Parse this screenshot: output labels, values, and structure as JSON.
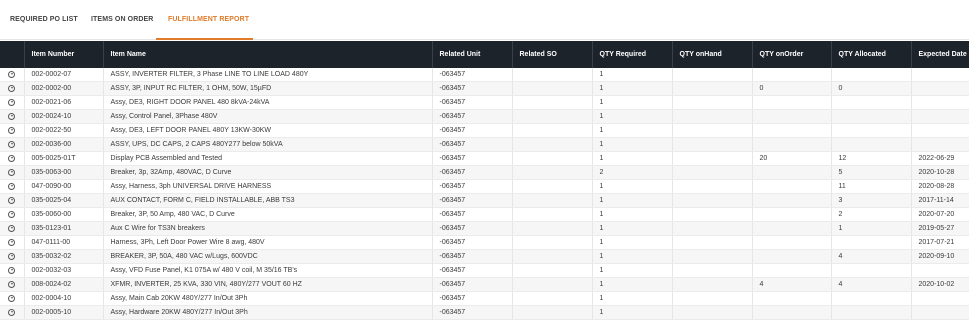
{
  "tabs": [
    {
      "label": "REQUIRED PO LIST"
    },
    {
      "label": "ITEMS ON ORDER"
    },
    {
      "label": "FULFILLMENT REPORT",
      "active": true
    }
  ],
  "accent_color": "#e07b2a",
  "header_bg": "#1d232b",
  "columns": [
    "",
    "Item Number",
    "Item Name",
    "Related Unit",
    "Related SO",
    "QTY Required",
    "QTY onHand",
    "QTY onOrder",
    "QTY Allocated",
    "Expected Date"
  ],
  "rows": [
    {
      "item": "002-0002-07",
      "name": "ASSY, INVERTER FILTER, 3 Phase LINE TO LINE LOAD 480Y",
      "unit": "-063457",
      "so": "",
      "req": "1",
      "onhand": "",
      "onorder": "",
      "alloc": "",
      "date": ""
    },
    {
      "item": "002-0002-00",
      "name": "ASSY, 3P, INPUT RC FILTER, 1 OHM, 50W, 15µFD",
      "unit": "-063457",
      "so": "",
      "req": "1",
      "onhand": "",
      "onorder": "0",
      "alloc": "0",
      "date": ""
    },
    {
      "item": "002-0021-06",
      "name": "Assy, DE3, RIGHT DOOR PANEL 480 8kVA-24kVA",
      "unit": "-063457",
      "so": "",
      "req": "1",
      "onhand": "",
      "onorder": "",
      "alloc": "",
      "date": ""
    },
    {
      "item": "002-0024-10",
      "name": "Assy, Control Panel, 3Phase 480V",
      "unit": "-063457",
      "so": "",
      "req": "1",
      "onhand": "",
      "onorder": "",
      "alloc": "",
      "date": ""
    },
    {
      "item": "002-0022-50",
      "name": "Assy, DE3, LEFT DOOR PANEL 480Y 13KW-30KW",
      "unit": "-063457",
      "so": "",
      "req": "1",
      "onhand": "",
      "onorder": "",
      "alloc": "",
      "date": ""
    },
    {
      "item": "002-0036-00",
      "name": "ASSY, UPS, DC CAPS, 2 CAPS 480Y277 below 50kVA",
      "unit": "-063457",
      "so": "",
      "req": "1",
      "onhand": "",
      "onorder": "",
      "alloc": "",
      "date": ""
    },
    {
      "item": "005-0025-01T",
      "name": "Display PCB Assembled and Tested",
      "unit": "-063457",
      "so": "",
      "req": "1",
      "onhand": "",
      "onorder": "20",
      "alloc": "12",
      "date": "2022-06-29"
    },
    {
      "item": "035-0063-00",
      "name": "Breaker, 3p, 32Amp, 480VAC, D Curve",
      "unit": "-063457",
      "so": "",
      "req": "2",
      "onhand": "",
      "onorder": "",
      "alloc": "5",
      "date": "2020-10-28"
    },
    {
      "item": "047-0090-00",
      "name": "Assy, Harness, 3ph UNIVERSAL DRIVE HARNESS",
      "unit": "-063457",
      "so": "",
      "req": "1",
      "onhand": "",
      "onorder": "",
      "alloc": "11",
      "date": "2020-08-28"
    },
    {
      "item": "035-0025-04",
      "name": "AUX CONTACT, FORM C, FIELD INSTALLABLE, ABB TS3",
      "unit": "-063457",
      "so": "",
      "req": "1",
      "onhand": "",
      "onorder": "",
      "alloc": "3",
      "date": "2017-11-14"
    },
    {
      "item": "035-0060-00",
      "name": "Breaker, 3P, 50 Amp, 480 VAC, D Curve",
      "unit": "-063457",
      "so": "",
      "req": "1",
      "onhand": "",
      "onorder": "",
      "alloc": "2",
      "date": "2020-07-20"
    },
    {
      "item": "035-0123-01",
      "name": "Aux C Wire for TS3N breakers",
      "unit": "-063457",
      "so": "",
      "req": "1",
      "onhand": "",
      "onorder": "",
      "alloc": "1",
      "date": "2019-05-27"
    },
    {
      "item": "047-0111-00",
      "name": "Harness, 3Ph, Left Door Power Wire 8 awg, 480V",
      "unit": "-063457",
      "so": "",
      "req": "1",
      "onhand": "",
      "onorder": "",
      "alloc": "",
      "date": "2017-07-21"
    },
    {
      "item": "035-0032-02",
      "name": "BREAKER, 3P, 50A, 480 VAC w/Lugs, 600VDC",
      "unit": "-063457",
      "so": "",
      "req": "1",
      "onhand": "",
      "onorder": "",
      "alloc": "4",
      "date": "2020-09-10"
    },
    {
      "item": "002-0032-03",
      "name": "Assy, VFD Fuse Panel, K1 075A w/ 480 V coil, M 35/16 TB's",
      "unit": "-063457",
      "so": "",
      "req": "1",
      "onhand": "",
      "onorder": "",
      "alloc": "",
      "date": ""
    },
    {
      "item": "008-0024-02",
      "name": "XFMR, INVERTER, 25 KVA, 330 VIN, 480Y/277 VOUT 60 HZ",
      "unit": "-063457",
      "so": "",
      "req": "1",
      "onhand": "",
      "onorder": "4",
      "alloc": "4",
      "date": "2020-10-02"
    },
    {
      "item": "002-0004-10",
      "name": "Assy, Main Cab 20KW 480Y/277 In/Out 3Ph",
      "unit": "-063457",
      "so": "",
      "req": "1",
      "onhand": "",
      "onorder": "",
      "alloc": "",
      "date": ""
    },
    {
      "item": "002-0005-10",
      "name": "Assy, Hardware 20KW 480Y/277 In/Out 3Ph",
      "unit": "-063457",
      "so": "",
      "req": "1",
      "onhand": "",
      "onorder": "",
      "alloc": "",
      "date": ""
    }
  ]
}
